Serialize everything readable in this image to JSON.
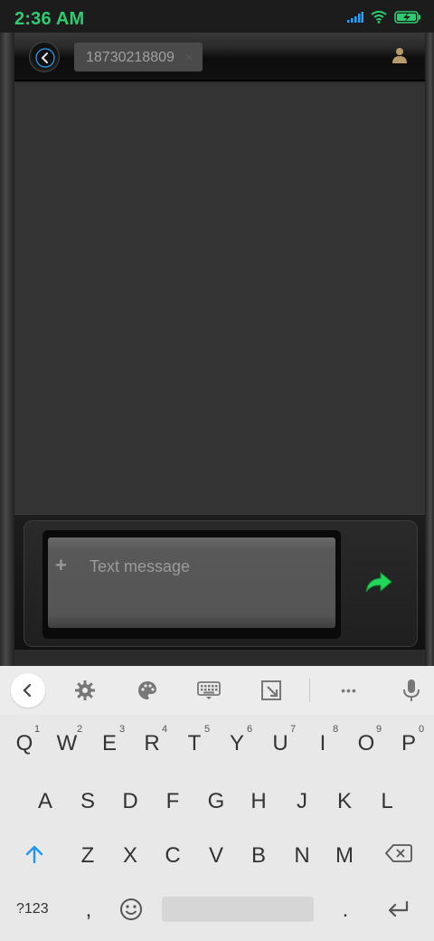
{
  "status_bar": {
    "time": "2:36 AM",
    "time_color": "#2ecc71",
    "icons": [
      "signal-icon",
      "wifi-icon",
      "battery-charging-icon"
    ]
  },
  "header": {
    "back_icon": "chevron-left-icon",
    "recipient": "18730218809",
    "remove_glyph": "×",
    "contact_icon": "person-icon"
  },
  "compose": {
    "placeholder": "Text message",
    "attach_glyph": "+",
    "send_icon": "send-arrow-icon",
    "send_color": "#22d65a"
  },
  "keyboard": {
    "toolbar": [
      "chevron-left-icon",
      "gear-icon",
      "palette-icon",
      "keyboard-icon",
      "resize-icon",
      "more-icon",
      "microphone-icon"
    ],
    "more_glyph": "•••",
    "row1": [
      "Q",
      "W",
      "E",
      "R",
      "T",
      "Y",
      "U",
      "I",
      "O",
      "P"
    ],
    "row1_hints": [
      "1",
      "2",
      "3",
      "4",
      "5",
      "6",
      "7",
      "8",
      "9",
      "0"
    ],
    "row2": [
      "A",
      "S",
      "D",
      "F",
      "G",
      "H",
      "J",
      "K",
      "L"
    ],
    "row3": [
      "Z",
      "X",
      "C",
      "V",
      "B",
      "N",
      "M"
    ],
    "symbols_label": "?123",
    "comma": ",",
    "period": ".",
    "accent_color": "#2196f3"
  }
}
